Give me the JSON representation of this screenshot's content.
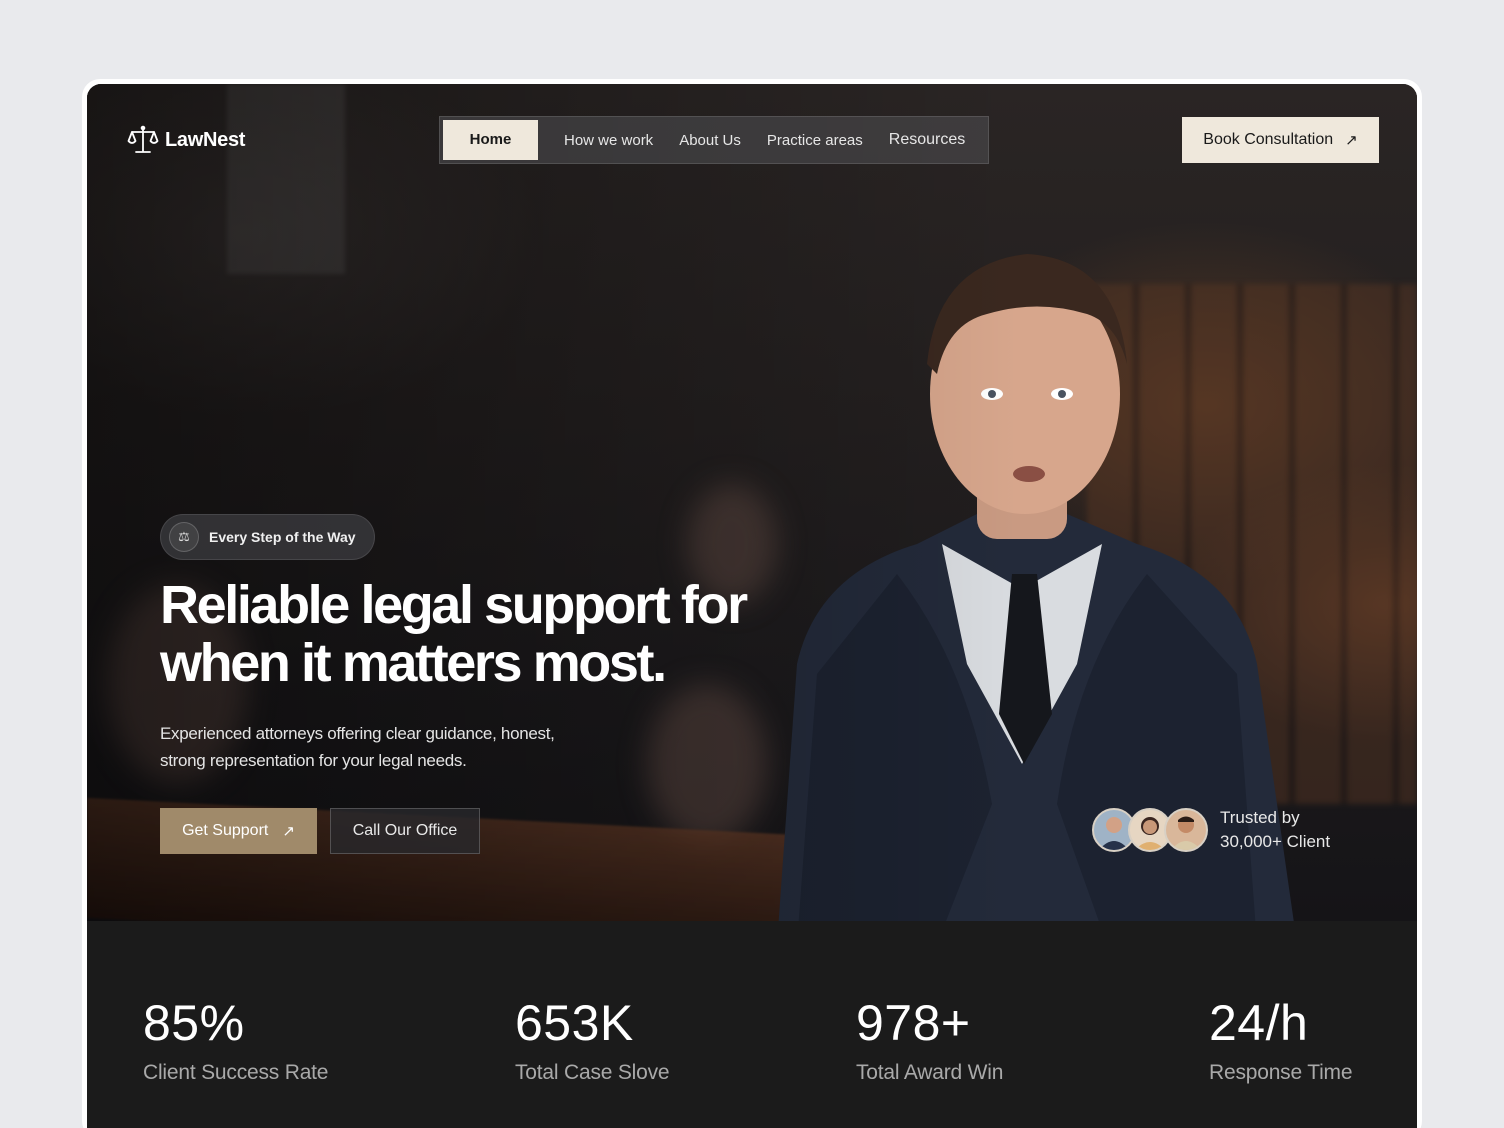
{
  "brand": {
    "name": "LawNest",
    "icon": "scales-of-justice-icon"
  },
  "nav": {
    "items": [
      {
        "label": "Home",
        "active": true
      },
      {
        "label": "How we work",
        "active": false
      },
      {
        "label": "About Us",
        "active": false
      },
      {
        "label": "Practice areas",
        "active": false
      },
      {
        "label": "Resources",
        "active": false
      }
    ]
  },
  "header": {
    "cta_label": "Book Consultation",
    "cta_icon": "arrow-up-right-icon"
  },
  "hero": {
    "badge": {
      "icon": "gavel-icon",
      "text": "Every Step of the Way"
    },
    "headline_line1": "Reliable legal support for",
    "headline_line2": "when it matters most.",
    "subtext_line1": "Experienced attorneys offering clear guidance, honest,",
    "subtext_line2": "strong representation for your legal needs.",
    "primary_button": "Get Support",
    "secondary_button": "Call Our Office",
    "trusted_line1": "Trusted by",
    "trusted_line2": "30,000+ Client"
  },
  "stats": [
    {
      "value": "85%",
      "label": "Client Success Rate"
    },
    {
      "value": "653K",
      "label": "Total Case Slove"
    },
    {
      "value": "978+",
      "label": "Total Award Win"
    },
    {
      "value": "24/h",
      "label": "Response Time"
    }
  ],
  "colors": {
    "accent": "#a08a6a",
    "cream": "#efe8dc",
    "dark": "#1b1b1b"
  }
}
